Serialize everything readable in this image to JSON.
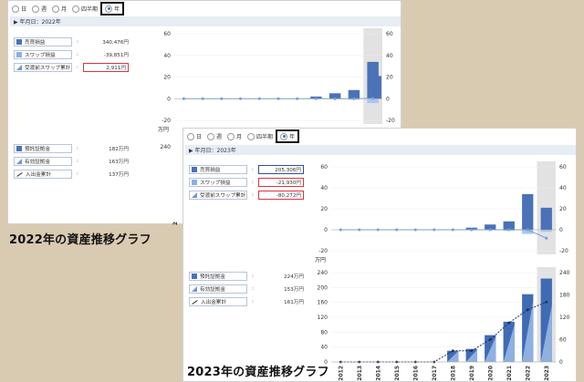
{
  "panel1": {
    "radios": [
      {
        "label": "日",
        "selected": false
      },
      {
        "label": "週",
        "selected": false
      },
      {
        "label": "月",
        "selected": false
      },
      {
        "label": "四半期",
        "selected": false
      },
      {
        "label": "年",
        "selected": true
      }
    ],
    "date_label": "▶ 年月日：2022年",
    "top_rows": [
      {
        "label": "売買損益",
        "value": "340,476円",
        "icon": "dark-square-icon",
        "box": ""
      },
      {
        "label": "スワップ損益",
        "value": "-39,851円",
        "icon": "light-square-icon",
        "box": ""
      },
      {
        "label": "受渡前スワップ累計",
        "value": "2,911円",
        "icon": "triangle-icon",
        "box": "red"
      }
    ],
    "bottom_rows": [
      {
        "label": "預託証拠金",
        "value": "182万円",
        "icon": "dark-square-icon"
      },
      {
        "label": "有効証拠金",
        "value": "163万円",
        "icon": "triangle-icon"
      },
      {
        "label": "入出金累計",
        "value": "137万円",
        "icon": "line-icon"
      }
    ],
    "chart_top_ticks": [
      "60",
      "40",
      "20",
      "0",
      "-20"
    ],
    "chart_top_unit": "万円",
    "chart_bottom_ticks": [
      "240"
    ],
    "x_tick": "2012"
  },
  "panel2": {
    "radios": [
      {
        "label": "日",
        "selected": false
      },
      {
        "label": "週",
        "selected": false
      },
      {
        "label": "月",
        "selected": false
      },
      {
        "label": "四半期",
        "selected": false
      },
      {
        "label": "年",
        "selected": true
      }
    ],
    "date_label": "▶ 年月日：2023年",
    "top_rows": [
      {
        "label": "売買損益",
        "value": "205,306円",
        "icon": "dark-square-icon",
        "box": "blue"
      },
      {
        "label": "スワップ損益",
        "value": "-21,930円",
        "icon": "light-square-icon",
        "box": "red"
      },
      {
        "label": "受渡前スワップ累計",
        "value": "-80,272円",
        "icon": "triangle-icon",
        "box": "red"
      }
    ],
    "bottom_rows": [
      {
        "label": "預託証拠金",
        "value": "224万円",
        "icon": "dark-square-icon"
      },
      {
        "label": "有効証拠金",
        "value": "153万円",
        "icon": "triangle-icon"
      },
      {
        "label": "入出金累計",
        "value": "161万円",
        "icon": "line-icon"
      }
    ],
    "chart_top_ticks": [
      "60",
      "40",
      "20",
      "0",
      "-20"
    ],
    "chart_top_unit": "万円",
    "chart_bottom_ticks": [
      "240",
      "200",
      "160",
      "120",
      "80",
      "40",
      "0"
    ],
    "chart_bottom_right_ticks": [
      "240",
      "180",
      "120",
      "60",
      "0"
    ]
  },
  "captions": {
    "caption1": "2022年の資産推移グラフ",
    "caption2": "2023年の資産推移グラフ"
  },
  "chart_data": [
    {
      "type": "bar",
      "title": "",
      "categories": [
        "2012",
        "2013",
        "2014",
        "2015",
        "2016",
        "2017",
        "2018",
        "2019",
        "2020",
        "2021",
        "2022"
      ],
      "series": [
        {
          "values": [
            0,
            0,
            0,
            0,
            0,
            0,
            0,
            2,
            5,
            8,
            34
          ]
        },
        {
          "values": [
            0,
            0,
            0,
            0,
            0,
            0,
            0,
            0,
            0,
            -1,
            -4
          ]
        }
      ],
      "overlay_line": [
        0,
        0,
        0,
        0,
        0,
        0,
        0,
        0,
        0,
        0,
        0.3
      ],
      "overlay_line_right": [
        0,
        0,
        0,
        0,
        0,
        0,
        0,
        0,
        0,
        0,
        -1
      ],
      "last_bar": 21,
      "ylim": [
        -20,
        60
      ],
      "ylabel": "万円",
      "highlight_category": "2022"
    },
    {
      "type": "bar",
      "title": "",
      "categories": [
        "2012",
        "2013",
        "2014",
        "2015",
        "2016",
        "2017",
        "2018",
        "2019",
        "2020",
        "2021",
        "2022",
        "2023"
      ],
      "series": [
        {
          "values": [
            0,
            0,
            0,
            0,
            0,
            0,
            0,
            2,
            5,
            8,
            34,
            21
          ]
        },
        {
          "values": [
            0,
            0,
            0,
            0,
            0,
            0,
            0,
            0,
            0,
            -1,
            -4,
            -2
          ]
        }
      ],
      "overlay_line": [
        0,
        0,
        0,
        0,
        0,
        0,
        0,
        0,
        0,
        0,
        0,
        -8
      ],
      "ylim": [
        -20,
        60
      ],
      "ylabel": "万円",
      "highlight_category": "2023"
    },
    {
      "type": "bar",
      "title": "",
      "categories": [
        "2012",
        "2013",
        "2014",
        "2015",
        "2016",
        "2017",
        "2018",
        "2019",
        "2020",
        "2021",
        "2022",
        "2023"
      ],
      "series": [
        {
          "values": [
            0,
            0,
            0,
            0,
            0,
            0,
            30,
            35,
            72,
            108,
            182,
            224
          ]
        },
        {
          "values": [
            0,
            0,
            0,
            0,
            0,
            0,
            30,
            33,
            68,
            100,
            165,
            153
          ]
        }
      ],
      "line": [
        0,
        0,
        0,
        0,
        0,
        0,
        30,
        30,
        60,
        105,
        140,
        161
      ],
      "ylim": [
        0,
        240
      ],
      "highlight_category": "2023"
    }
  ]
}
